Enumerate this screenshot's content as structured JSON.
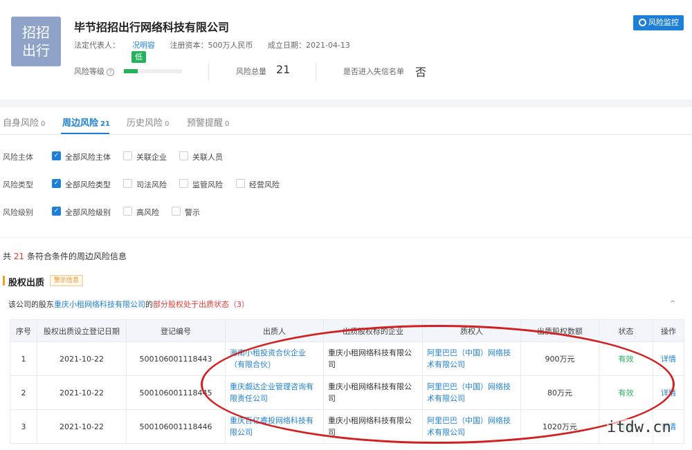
{
  "company": {
    "logo_text": "招招\n出行",
    "name": "毕节招招出行网络科技有限公司",
    "legal_rep_label": "法定代表人：",
    "legal_rep": "况明容",
    "capital": "注册资本：500万人民币",
    "established": "成立日期：2021-04-13",
    "monitor_button": "风险监控"
  },
  "risk": {
    "level_label": "风险等级",
    "level_value": "低",
    "level_fraction": 0.24,
    "help_icon": "?",
    "total_label": "风险总量",
    "total_value": "21",
    "blacklist_label": "是否进入失信名单",
    "blacklist_value": "否"
  },
  "tabs": [
    {
      "label": "自身风险",
      "count": "0"
    },
    {
      "label": "周边风险",
      "count": "21"
    },
    {
      "label": "历史风险",
      "count": "0"
    },
    {
      "label": "预警提醒",
      "count": "0"
    }
  ],
  "filters": [
    {
      "label": "风险主体",
      "options": [
        "全部风险主体",
        "关联企业",
        "关联人员"
      ]
    },
    {
      "label": "风险类型",
      "options": [
        "全部风险类型",
        "司法风险",
        "监管风险",
        "经营风险"
      ]
    },
    {
      "label": "风险级别",
      "options": [
        "全部风险级别",
        "高风险",
        "警示"
      ]
    }
  ],
  "summary": {
    "prefix": "共",
    "count": "21",
    "suffix": "条符合条件的周边风险信息"
  },
  "section": {
    "title": "股权出质",
    "tag": "警示信息"
  },
  "desc": {
    "prefix": "该公司的股东",
    "shareholder": "重庆小租网络科技有限公司",
    "mid": "的",
    "warning": "部分股权处于出质状态",
    "count": "（3）",
    "collapse": "^"
  },
  "table": {
    "headers": [
      "序号",
      "股权出质设立登记日期",
      "登记编号",
      "出质人",
      "出质股权标的企业",
      "质权人",
      "出质股权数额",
      "状态",
      "操作"
    ],
    "rows": [
      [
        "1",
        "2021-10-22",
        "500106001118443",
        "海南小租投资合伙企业（有限合伙）",
        "重庆小租网络科技有限公司",
        "阿里巴巴（中国）网络技术有限公司",
        "900万元",
        "有效",
        "详情"
      ],
      [
        "2",
        "2021-10-22",
        "500106001118445",
        "重庆觑达企业管理咨询有限责任公司",
        "重庆小租网络科技有限公司",
        "阿里巴巴（中国）网络技术有限公司",
        "80万元",
        "有效",
        "详情"
      ],
      [
        "3",
        "2021-10-22",
        "500106001118446",
        "重庆百亿睿投网络科技有限公司",
        "重庆小租网络科技有限公司",
        "阿里巴巴（中国）网络技术有限公司",
        "1020万元",
        "有效",
        "详情"
      ]
    ]
  },
  "watermark": "itdw.cn"
}
